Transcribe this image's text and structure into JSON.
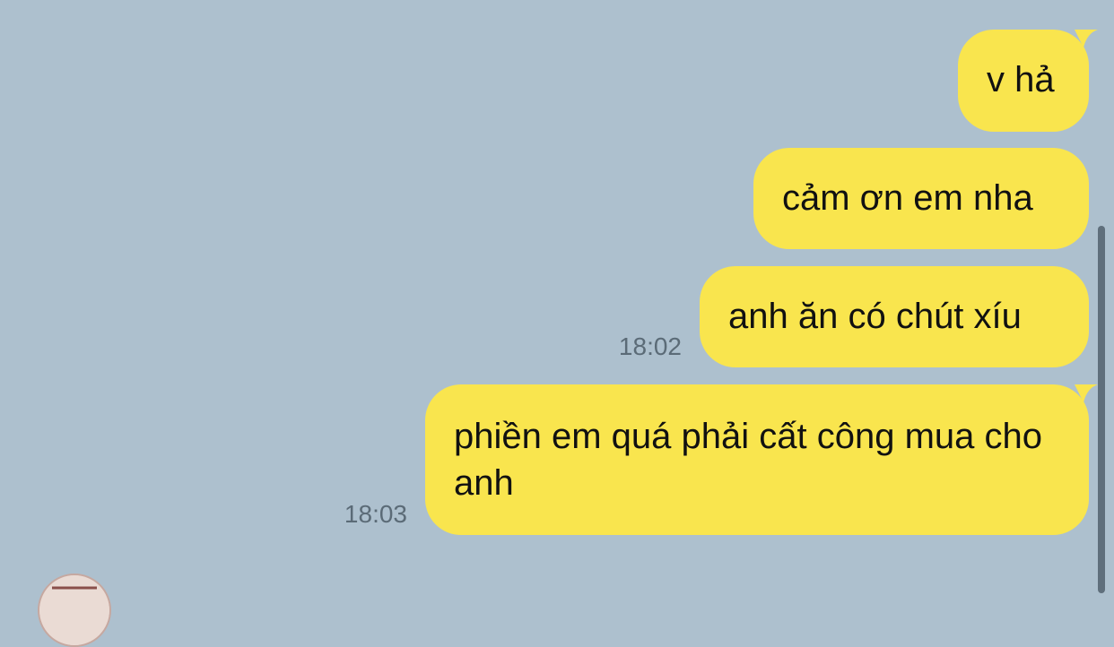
{
  "messages": [
    {
      "text": "v hả",
      "time": ""
    },
    {
      "text": "cảm ơn em nha",
      "time": ""
    },
    {
      "text": "anh ăn có chút xíu",
      "time": "18:02"
    },
    {
      "text": "phiền em quá phải cất công mua cho anh",
      "time": "18:03"
    }
  ],
  "colors": {
    "background": "#adc0ce",
    "outgoing_bubble": "#f9e54e",
    "timestamp": "#5b6b77",
    "scrollbar": "#5f6f7c"
  },
  "icons": {
    "avatar": "contact-avatar"
  }
}
